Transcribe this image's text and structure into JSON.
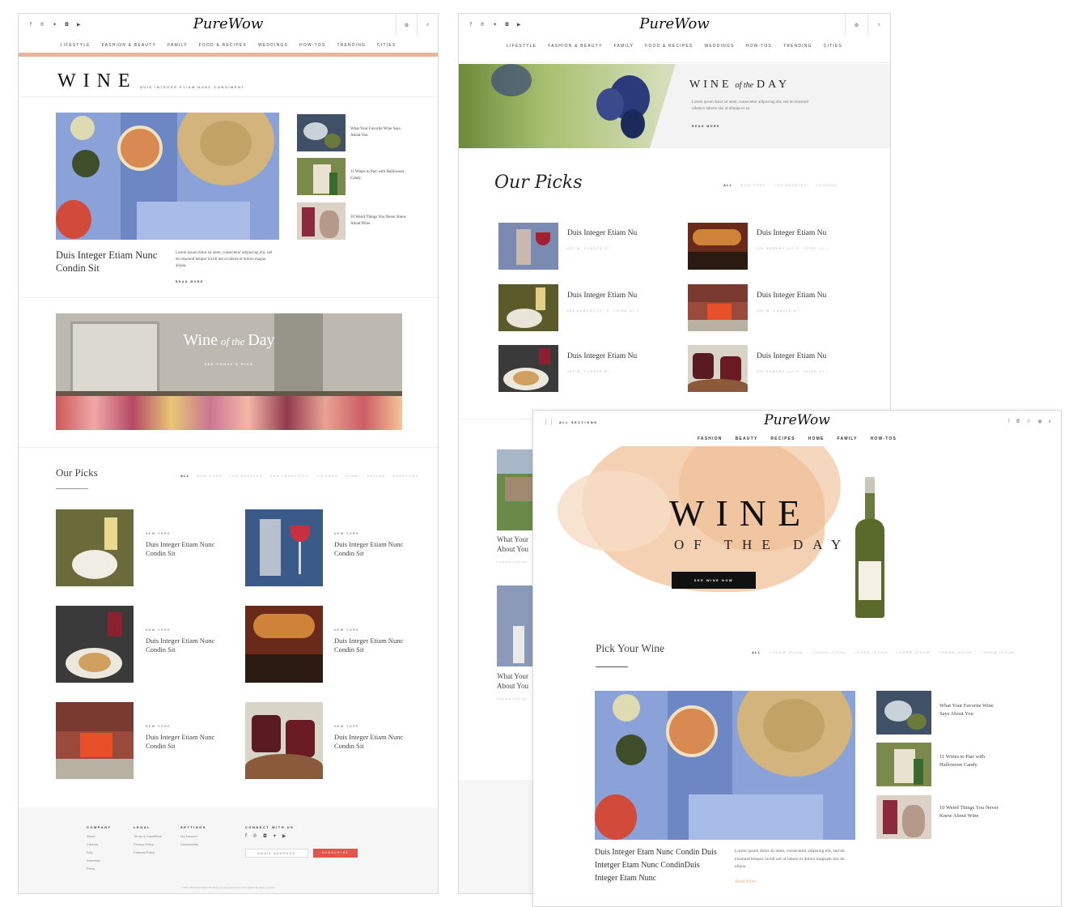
{
  "brand": "PureWow",
  "colors": {
    "accent": "#e8b49a",
    "subscribe": "#e0574f",
    "ink": "#111111"
  },
  "icons": {
    "social": [
      "facebook-icon",
      "pinterest-icon",
      "twitter-icon",
      "instagram-icon",
      "youtube-icon"
    ],
    "utility": [
      "gear-icon",
      "search-icon"
    ]
  },
  "p1": {
    "nav": [
      "Lifestyle",
      "Fashion & Beauty",
      "Family",
      "Food & Recipes",
      "Weddings",
      "How-Tos",
      "Trending",
      "Cities"
    ],
    "title": "WINE",
    "tagline": "Duis integer etiam nunc condiment",
    "hero_title": "Duis Integer Etiam Nunc Condin Sit",
    "hero_body": "Lorem ipsum dolor sit amet, consectetur adipiscing elit, sed do eiusmod tempor incidi unt ut labore et dolore magna aliqua.",
    "read_more": "Read More",
    "side": [
      "What Your Favorite Wine Says About You",
      "11 Wines to Pair with Halloween Candy",
      "10 Weird Things You Never Knew About Wine"
    ],
    "banner_a": "Wine",
    "banner_b": "of the",
    "banner_c": "Day",
    "banner_cta": "See Today's Pick",
    "picks_title": "Our Picks",
    "tabs": [
      "All",
      "New York",
      "Los Angeles",
      "San Francisco",
      "Chicago",
      "Miami",
      "Dallas",
      "Hamptons"
    ],
    "pick_tag": "New York",
    "picks": [
      "Duis Integer Etiam Nunc Condin Sit",
      "Duis Integer Etiam Nunc Condin Sit",
      "Duis Integer Etiam Nunc Condin Sit",
      "Duis Integer Etiam Nunc Condin Sit",
      "Duis Integer Etiam Nunc Condin Sit",
      "Duis Integer Etiam Nunc Condin Sit"
    ],
    "footer": {
      "cols": [
        {
          "h": "Company",
          "items": [
            "About",
            "Careers",
            "FAQ",
            "Advertise",
            "Press"
          ]
        },
        {
          "h": "Legal",
          "items": [
            "Terms & Conditions",
            "Privacy Policy",
            "Editorial Policy"
          ]
        },
        {
          "h": "Settings",
          "items": [
            "My Account",
            "Unsubscribe"
          ]
        }
      ],
      "connect": "Connect with us",
      "email_placeholder": "Email Address",
      "subscribe": "Subscribe",
      "copyright": "© 2011-2017 Wow Media Products, Inc doing business as PureWow. All rights reserved."
    }
  },
  "p2": {
    "nav": [
      "Lifestyle",
      "Fashion & Beauty",
      "Family",
      "Food & Recipes",
      "Weddings",
      "How-Tos",
      "Trending",
      "Cities"
    ],
    "wotd_a": "WINE",
    "wotd_b": "of the",
    "wotd_c": "DAY",
    "wotd_body": "Lorem ipsum dolor sit amet, consectetur adipiscing elit, sed do eiusmod ullamco laboris nisi ut aliquip ex ea",
    "read_more": "Read More",
    "picks_title": "Our Picks",
    "tabs": [
      "All",
      "New York",
      "Los Angeles",
      "Chicago"
    ],
    "items": [
      {
        "title": "Duis Integer Etiam Nu",
        "addr": "250 W. Fourth St."
      },
      {
        "title": "Duis Integer Etiam Nu",
        "addr": "335 Bowery (at E. Third St.)"
      },
      {
        "title": "Duis Integer Etiam Nu",
        "addr": "335 Bowery (at E. Third St.)"
      },
      {
        "title": "Duis Integer Etiam Nu",
        "addr": "250 W. Fourth St."
      },
      {
        "title": "Duis Integer Etiam Nu",
        "addr": "250 W. Fourth St."
      },
      {
        "title": "Duis Integer Etiam Nu",
        "addr": "335 Bowery (at E. Third St.)"
      }
    ],
    "peek": [
      {
        "title": "What Your About You",
        "tag": "Lorem Ipsum"
      },
      {
        "title": "What Your About You",
        "tag": "Lorem Ipsum"
      }
    ]
  },
  "p3": {
    "all_sections": "All Sections",
    "nav": [
      "Fashion",
      "Beauty",
      "Recipes",
      "Home",
      "Family",
      "How-Tos"
    ],
    "hero_a": "WINE",
    "hero_b": "OF THE DAY",
    "cta": "See Wine Now",
    "pick_title": "Pick Your Wine",
    "tabs": [
      "All",
      "Lorem Ipsum",
      "Lorem Ipsum",
      "Lorem Ipsum",
      "Lorem Ipsum",
      "Lorem Ipsum",
      "Lorem Ipsum"
    ],
    "feature_title": "Duis Integer Etam Nunc Condin Duis Intetger Etam Nunc CondinDuis Integer Etam Nunc",
    "feature_body": "Lorem ipsum dolor sit amet, consectetur adipising elit, sed do eiusmod tempor incidi unt ut labore et dolore magnam dos do aliqua .",
    "read_more": "Read More",
    "side": [
      "What Your Favorite Wine Says About You",
      "11 Wines to Pair with Halloween Candy",
      "10 Weird Things You Never Knew About Wine"
    ]
  }
}
